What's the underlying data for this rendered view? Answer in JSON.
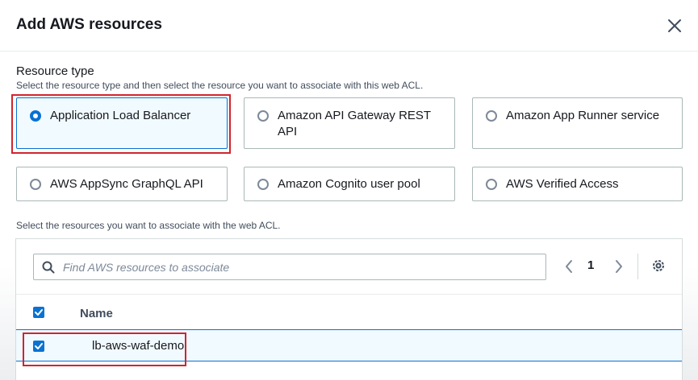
{
  "dialog": {
    "title": "Add AWS resources"
  },
  "resource_type": {
    "label": "Resource type",
    "description": "Select the resource type and then select the resource you want to associate with this web ACL.",
    "options": [
      {
        "label": "Application Load Balancer",
        "selected": true
      },
      {
        "label": "Amazon API Gateway REST API",
        "selected": false
      },
      {
        "label": "Amazon App Runner service",
        "selected": false
      },
      {
        "label": "AWS AppSync GraphQL API",
        "selected": false
      },
      {
        "label": "Amazon Cognito user pool",
        "selected": false
      },
      {
        "label": "AWS Verified Access",
        "selected": false
      }
    ]
  },
  "resources": {
    "description": "Select the resources you want to associate with the web ACL.",
    "search_placeholder": "Find AWS resources to associate",
    "page_number": "1",
    "column_name": "Name",
    "rows": [
      {
        "name": "lb-aws-waf-demo",
        "checked": true
      }
    ]
  },
  "colors": {
    "accent": "#0972d3",
    "highlight_outline": "#d1242f",
    "selected_bg": "#f1faff"
  }
}
